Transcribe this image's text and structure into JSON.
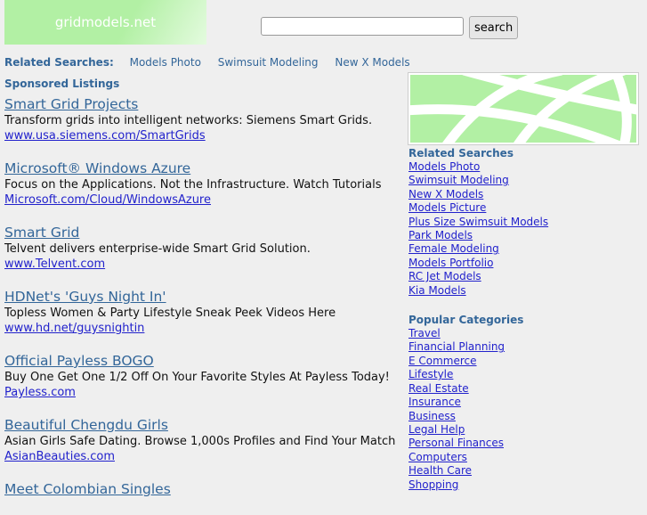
{
  "site": {
    "logo_text": "gridmodels.net"
  },
  "search": {
    "value": "",
    "button": "search"
  },
  "related_bar": {
    "label": "Related Searches:",
    "links": [
      "Models Photo",
      "Swimsuit Modeling",
      "New X Models"
    ]
  },
  "sponsored_label": "Sponsored Listings",
  "ads": [
    {
      "title": "Smart Grid Projects",
      "desc": "Transform grids into intelligent networks: Siemens Smart Grids.",
      "url": "www.usa.siemens.com/SmartGrids"
    },
    {
      "title": "Microsoft® Windows Azure",
      "desc": "Focus on the Applications. Not the Infrastructure. Watch Tutorials",
      "url": "Microsoft.com/Cloud/WindowsAzure"
    },
    {
      "title": "Smart Grid",
      "desc": "Telvent delivers enterprise-wide Smart Grid Solution.",
      "url": "www.Telvent.com"
    },
    {
      "title": "HDNet's 'Guys Night In'",
      "desc": "Topless Women & Party Lifestyle Sneak Peek Videos Here",
      "url": "www.hd.net/guysnightin"
    },
    {
      "title": "Official Payless BOGO",
      "desc": "Buy One Get One 1/2 Off On Your Favorite Styles At Payless Today!",
      "url": "Payless.com"
    },
    {
      "title": "Beautiful Chengdu Girls",
      "desc": "Asian Girls Safe Dating. Browse 1,000s Profiles and Find Your Match",
      "url": "AsianBeauties.com"
    },
    {
      "title": "Meet Colombian Singles"
    }
  ],
  "sidebar": {
    "related_title": "Related Searches",
    "related": [
      "Models Photo",
      "Swimsuit Modeling",
      "New X Models",
      "Models Picture",
      "Plus Size Swimsuit Models",
      "Park Models",
      "Female Modeling",
      "Models Portfolio",
      "RC Jet Models",
      "Kia Models"
    ],
    "popular_title": "Popular Categories",
    "popular": [
      "Travel",
      "Financial Planning",
      "E Commerce",
      "Lifestyle",
      "Real Estate",
      "Insurance",
      "Business",
      "Legal Help",
      "Personal Finances",
      "Computers",
      "Health Care",
      "Shopping"
    ]
  }
}
